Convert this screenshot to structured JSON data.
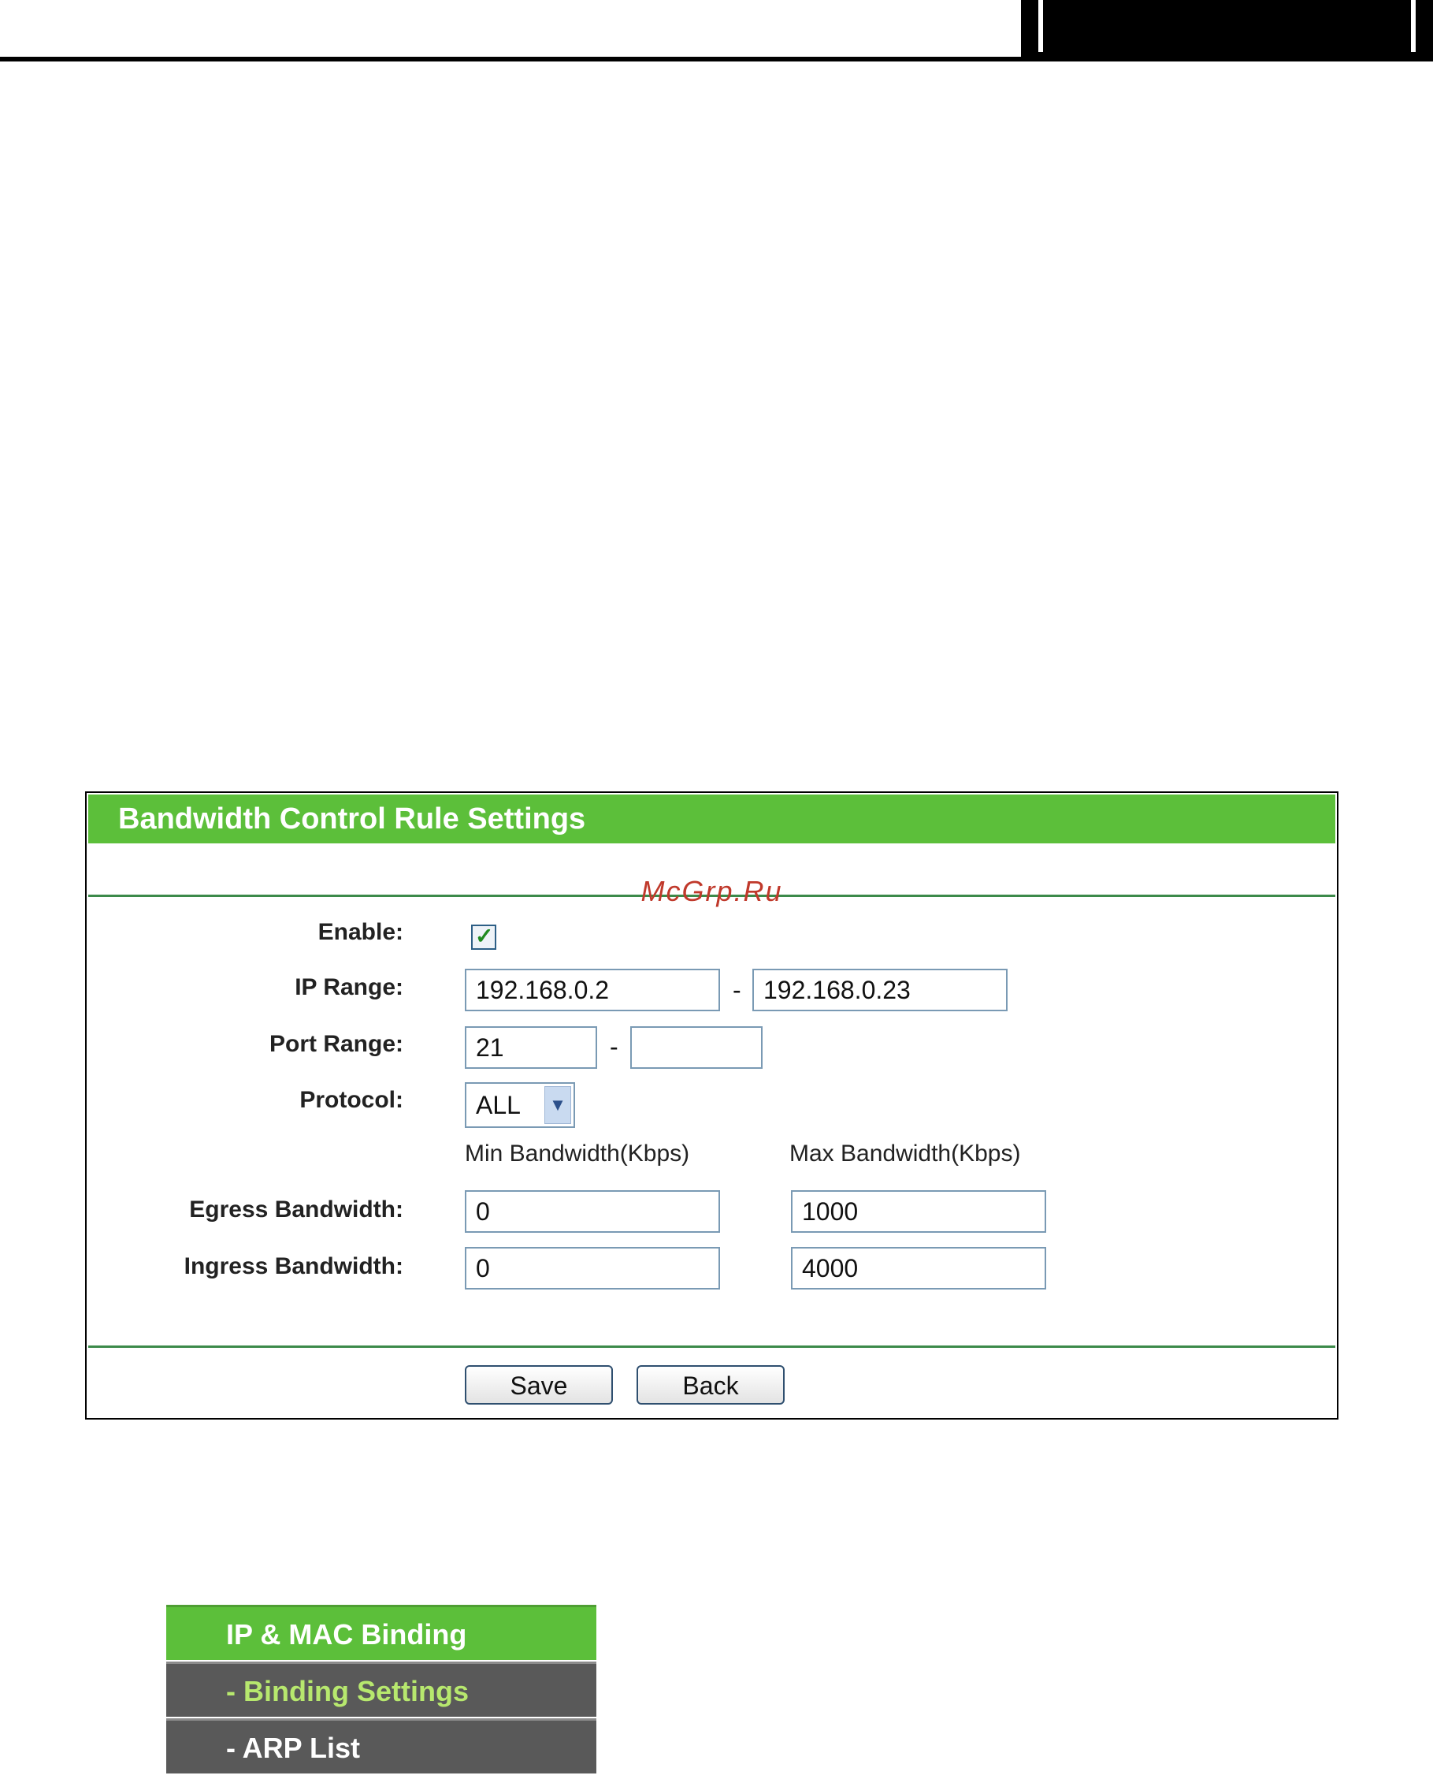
{
  "panel": {
    "title": "Bandwidth Control Rule Settings",
    "watermark": "McGrp.Ru",
    "enable_label": "Enable:",
    "enable_checked": true,
    "ip_range_label": "IP Range:",
    "ip_start": "192.168.0.2",
    "ip_dash": "-",
    "ip_end": "192.168.0.23",
    "port_range_label": "Port Range:",
    "port_start": "21",
    "port_dash": "-",
    "port_end": "",
    "protocol_label": "Protocol:",
    "protocol_value": "ALL",
    "min_header": "Min Bandwidth(Kbps)",
    "max_header": "Max Bandwidth(Kbps)",
    "egress_label": "Egress Bandwidth:",
    "egress_min": "0",
    "egress_max": "1000",
    "ingress_label": "Ingress Bandwidth:",
    "ingress_min": "0",
    "ingress_max": "4000",
    "save_label": "Save",
    "back_label": "Back"
  },
  "menu": {
    "items": [
      {
        "label": "IP & MAC Binding"
      },
      {
        "label": "- Binding Settings"
      },
      {
        "label": "- ARP List"
      }
    ]
  },
  "colors": {
    "header_green": "#5cbf3a",
    "divider_green": "#3c8a4a",
    "menu_gray": "#595959",
    "active_text": "#b7e86e"
  }
}
